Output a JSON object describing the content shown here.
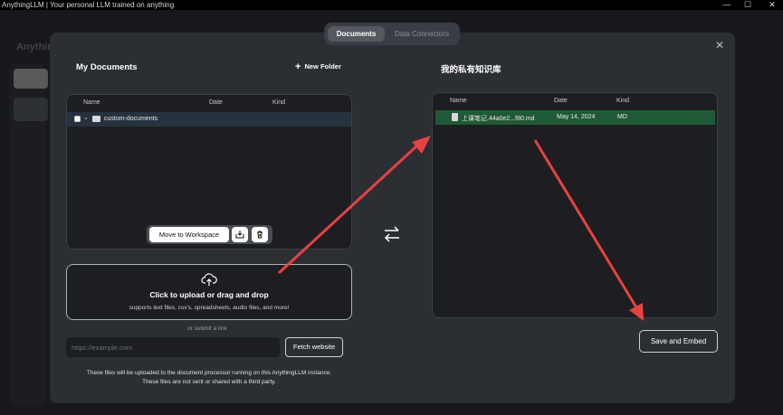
{
  "window": {
    "title": "AnythingLLM | Your personal LLM trained on anything",
    "controls": [
      "—",
      "☐",
      "✕"
    ]
  },
  "background": {
    "logo_text": "AnythingLLM"
  },
  "modal": {
    "tabs": [
      {
        "label": "Documents",
        "active": true
      },
      {
        "label": "Data Connectors",
        "active": false
      }
    ],
    "close_symbol": "✕",
    "my_documents": {
      "title": "My Documents",
      "new_folder_label": "New Folder",
      "columns": [
        "Name",
        "Date",
        "Kind"
      ],
      "rows": [
        {
          "name": "custom-documents",
          "date": "",
          "kind": ""
        }
      ],
      "actions": {
        "move_label": "Move to Workspace",
        "embed_icon": "embed-icon",
        "delete_icon": "trash-icon"
      }
    },
    "upload": {
      "title": "Click to upload or drag and drop",
      "subtitle": "supports text files, csv's, spreadsheets, audio files, and more!",
      "or_link": "or submit a link",
      "url_placeholder": "https://example.com",
      "fetch_label": "Fetch website",
      "note_line1": "These files will be uploaded to the document processor running on this AnythingLLM instance.",
      "note_line2": "These files are not sent or shared with a third party."
    },
    "workspace": {
      "title": "我的私有知识库",
      "columns": [
        "Name",
        "Date",
        "Kind"
      ],
      "rows": [
        {
          "name": "上课笔记.44a0e2...f80.md",
          "date": "May 14, 2024",
          "kind": "MD"
        }
      ],
      "save_label": "Save and Embed"
    }
  },
  "colors": {
    "modal_bg": "#2b2e33",
    "panel_bg": "#1c1e21",
    "selected_row_left": "#263240",
    "selected_row_right": "#1f5a36",
    "annotation_arrow": "#e84142"
  }
}
